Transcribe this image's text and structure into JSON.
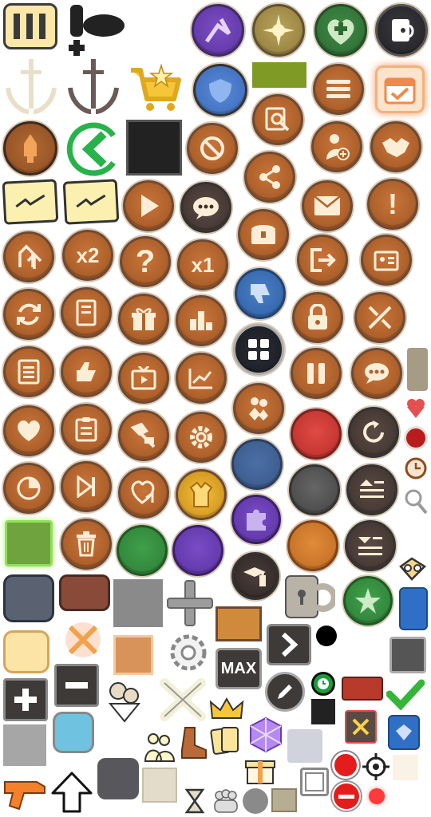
{
  "labels": {
    "x2": "x2",
    "x1": "x1",
    "max": "MAX",
    "question": "?",
    "exclaim": "!"
  },
  "colors": {
    "bronze": "#b0622c",
    "rim": "#6e4a33",
    "cream_glyph": "#fbeed6",
    "green_check": "#35b53a",
    "blue_ui": "#2f6fc6"
  },
  "icons": [
    "pause-ticket-icon",
    "joystick-plus-icon",
    "purple-skill-icon",
    "compass-sun-icon",
    "green-heal-icon",
    "exit-door-icon",
    "sword-laurel-cream-icon",
    "sword-laurel-dark-icon",
    "shop-cart-star-icon",
    "blue-shield-icon",
    "olive-bar-icon",
    "menu-icon",
    "calendar-check-icon",
    "inspect-icon",
    "rocket-icon",
    "back-arrow-icon",
    "black-square-icon",
    "forbid-icon",
    "user-add-icon",
    "handshake-icon",
    "ticket-stack-icon",
    "ticket-stack-2-icon",
    "play-icon",
    "chat-icon",
    "share-icon",
    "mail-icon",
    "alert-icon",
    "upgrade-arrows-icon",
    "speed-x2-icon",
    "help-icon",
    "speed-x1-icon",
    "treasure-chest-icon",
    "logout-icon",
    "id-card-icon",
    "thumbs-down-icon",
    "refresh-icon",
    "book-icon",
    "gift-icon",
    "ranking-icon",
    "lock-icon",
    "battle-swords-icon",
    "grid-menu-icon",
    "list-icon",
    "thumbs-up-icon",
    "tv-reward-icon",
    "stats-chart-icon",
    "pause-icon",
    "speech-bubble-icon",
    "gray-tab-icon",
    "friends-icon",
    "heart-icon",
    "clipboard-icon",
    "blacksmith-icon",
    "settings-gear-icon",
    "red-circle-icon",
    "restart-icon",
    "red-dot-icon",
    "timer-icon",
    "pie-chart-icon",
    "skip-end-icon",
    "heart-share-icon",
    "outfit-icon",
    "blue-circle-icon",
    "gray-circle-icon",
    "eject-list-icon",
    "search-icon",
    "green-frame-icon",
    "trash-icon",
    "green-circle-icon",
    "purple-circle-icon",
    "puzzle-icon",
    "orange-circle-icon",
    "download-list-icon",
    "slate-square-icon",
    "brown-tag-icon",
    "gray-square-icon",
    "plus-gray-icon",
    "tutorial-icon",
    "padlock-key-icon",
    "guild-emblem-icon",
    "map-pin-icon",
    "glasses-icon",
    "cream-square-icon",
    "crossed-swords-glow-icon",
    "tan-frame-icon",
    "gear-outline-icon",
    "wood-plank-icon",
    "next-arrow-icon",
    "max-icon",
    "black-dot-icon",
    "blue-tab-icon",
    "plus-square-icon",
    "minus-square-icon",
    "character-trio-icon",
    "close-x-icon",
    "crown-icon",
    "edit-pencil-icon",
    "stopwatch-icon",
    "red-banner-icon",
    "check-icon",
    "cyan-square-icon",
    "gray-block-icon",
    "group-icon",
    "boot-icon",
    "cards-icon",
    "gem-cube-icon",
    "light-square-icon",
    "gift-box-icon",
    "white-frame-icon",
    "red-button-icon",
    "target-icon",
    "ivory-square-icon",
    "orange-gun-icon",
    "up-arrow-icon",
    "dark-gray-square-icon",
    "beige-square-icon",
    "hourglass-icon",
    "crowd-icon",
    "small-gray-circle-icon",
    "small-tan-square-icon",
    "no-entry-icon",
    "small-red-dot-icon",
    "cancel-battle-icon",
    "blue-gem-icon",
    "black-square-small-icon",
    "gray-dark-square-icon",
    "white-shape-icon"
  ]
}
